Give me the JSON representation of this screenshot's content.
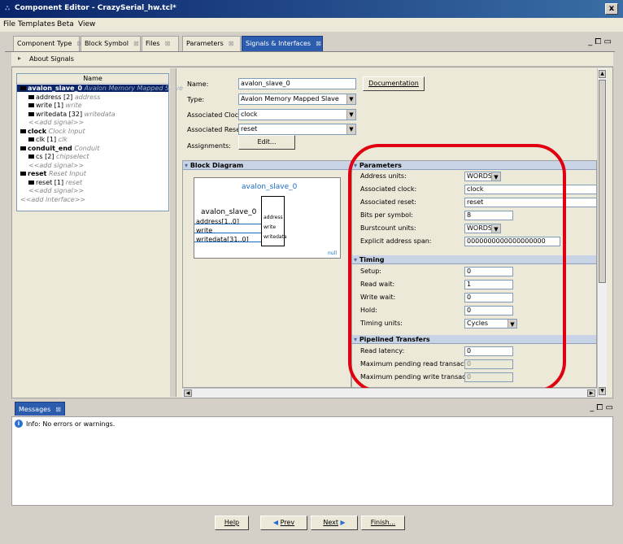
{
  "window": {
    "title": "Component Editor - CrazySerial_hw.tcl*",
    "close_label": "x"
  },
  "menu": [
    "File",
    "Templates",
    "Beta",
    "View"
  ],
  "tabs": [
    {
      "label": "Component Type",
      "close": "⊠"
    },
    {
      "label": "Block Symbol",
      "close": "⊠"
    },
    {
      "label": "Files",
      "close": "⊠"
    },
    {
      "label": "Parameters",
      "close": "⊠"
    },
    {
      "label": "Signals & Interfaces",
      "close": "⊠"
    }
  ],
  "about": {
    "label": "About Signals",
    "arrow": "▸"
  },
  "tree": {
    "header": "Name",
    "nodes": [
      {
        "name": "avalon_slave_0",
        "desc": "Avalon Memory Mapped Slave",
        "level": 0
      },
      {
        "name": "address [2]",
        "desc": "address",
        "level": 1
      },
      {
        "name": "write [1]",
        "desc": "write",
        "level": 1
      },
      {
        "name": "writedata [32]",
        "desc": "writedata",
        "level": 1
      },
      {
        "name": "",
        "desc": "<<add signal>>",
        "level": 1
      },
      {
        "name": "clock",
        "desc": "Clock Input",
        "level": 0
      },
      {
        "name": "clk [1]",
        "desc": "clk",
        "level": 1
      },
      {
        "name": "conduit_end",
        "desc": "Conduit",
        "level": 0
      },
      {
        "name": "cs [2]",
        "desc": "chipselect",
        "level": 1
      },
      {
        "name": "",
        "desc": "<<add signal>>",
        "level": 1
      },
      {
        "name": "reset",
        "desc": "Reset Input",
        "level": 0
      },
      {
        "name": "reset [1]",
        "desc": "reset",
        "level": 1
      },
      {
        "name": "",
        "desc": "<<add signal>>",
        "level": 1
      },
      {
        "name": "",
        "desc": "<<add interface>>",
        "level": 0
      }
    ]
  },
  "form": {
    "name_label": "Name:",
    "name_value": "avalon_slave_0",
    "type_label": "Type:",
    "type_value": "Avalon Memory Mapped Slave",
    "clock_label": "Associated Clock:",
    "clock_value": "clock",
    "reset_label": "Associated Reset:",
    "reset_value": "reset",
    "assign_label": "Assignments:",
    "edit_button": "Edit...",
    "doc_button": "Documentation"
  },
  "block": {
    "header": "Block Diagram",
    "title": "avalon_slave_0",
    "side_label": "avalon_slave_0",
    "signals": [
      "address[1..0]",
      "write",
      "writedata[31..0]"
    ],
    "ports": [
      "address",
      "write",
      "writedata"
    ],
    "null_label": "null"
  },
  "params": {
    "header": "Parameters",
    "rows": [
      {
        "label": "Address units:",
        "value": "WORDS",
        "kind": "dropdown"
      },
      {
        "label": "Associated clock:",
        "value": "clock",
        "kind": "text"
      },
      {
        "label": "Associated reset:",
        "value": "reset",
        "kind": "text"
      },
      {
        "label": "Bits per symbol:",
        "value": "8",
        "kind": "text"
      },
      {
        "label": "Burstcount units:",
        "value": "WORDS",
        "kind": "dropdown"
      },
      {
        "label": "Explicit address span:",
        "value": "0000000000000000000",
        "kind": "text"
      }
    ]
  },
  "timing": {
    "header": "Timing",
    "rows": [
      {
        "label": "Setup:",
        "value": "0"
      },
      {
        "label": "Read wait:",
        "value": "1"
      },
      {
        "label": "Write wait:",
        "value": "0"
      },
      {
        "label": "Hold:",
        "value": "0"
      },
      {
        "label": "Timing units:",
        "value": "Cycles"
      }
    ]
  },
  "pipelined": {
    "header": "Pipelined Transfers",
    "rows": [
      {
        "label": "Read latency:",
        "value": "0"
      },
      {
        "label": "Maximum pending read transactions:",
        "value": "0"
      },
      {
        "label": "Maximum pending write transactions:",
        "value": "0"
      }
    ]
  },
  "messages": {
    "tab": "Messages",
    "tab_close": "⊠",
    "info": "Info: No errors or warnings."
  },
  "footer": {
    "help": "Help",
    "prev": "Prev",
    "next": "Next",
    "finish": "Finish..."
  },
  "colors": {
    "accent": "#0a246a",
    "highlight": "#e0000f",
    "signal_blue": "#1a6bc4"
  }
}
